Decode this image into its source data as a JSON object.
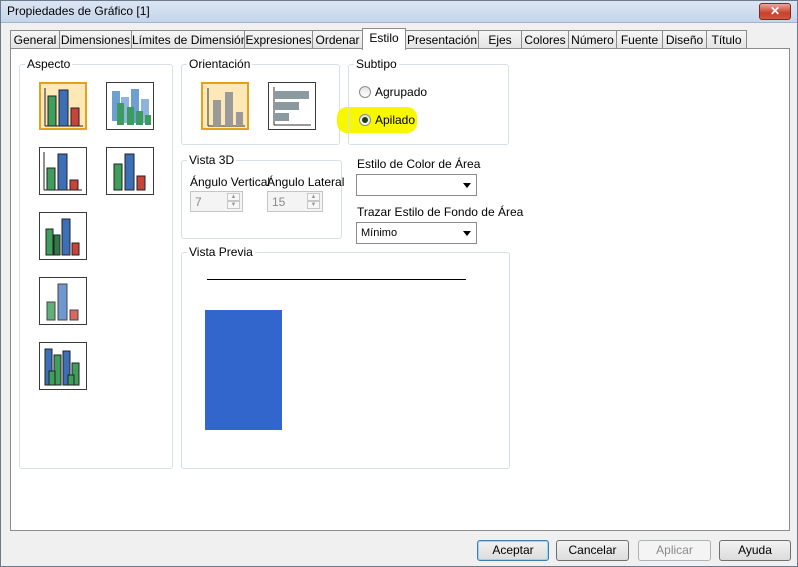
{
  "window": {
    "title": "Propiedades de Gráfico [1]",
    "close_glyph": "✕"
  },
  "tabs": [
    {
      "label": "General"
    },
    {
      "label": "Dimensiones"
    },
    {
      "label": "Límites de Dimensión"
    },
    {
      "label": "Expresiones"
    },
    {
      "label": "Ordenar"
    },
    {
      "label": "Estilo"
    },
    {
      "label": "Presentación"
    },
    {
      "label": "Ejes"
    },
    {
      "label": "Colores"
    },
    {
      "label": "Número"
    },
    {
      "label": "Fuente"
    },
    {
      "label": "Diseño"
    },
    {
      "label": "Título"
    }
  ],
  "active_tab": "Estilo",
  "aspecto": {
    "legend": "Aspecto"
  },
  "orientacion": {
    "legend": "Orientación"
  },
  "subtipo": {
    "legend": "Subtipo",
    "options": [
      {
        "label": "Agrupado",
        "checked": false
      },
      {
        "label": "Apilado",
        "checked": true
      }
    ]
  },
  "vista3d": {
    "legend": "Vista 3D",
    "vertical_label": "Ángulo Vertical",
    "vertical_value": "7",
    "lateral_label": "Ángulo Lateral",
    "lateral_value": "15"
  },
  "area": {
    "color_label": "Estilo de Color de Área",
    "color_value": "",
    "fondo_label": "Trazar Estilo de Fondo de Área",
    "fondo_value": "Mínimo"
  },
  "preview": {
    "legend": "Vista Previa",
    "bar_color": "#3366cc"
  },
  "buttons": {
    "accept": "Aceptar",
    "cancel": "Cancelar",
    "apply": "Aplicar",
    "help": "Ayuda"
  },
  "colors": {
    "highlight": "#f7f700",
    "selected_border": "#e3a21a"
  }
}
